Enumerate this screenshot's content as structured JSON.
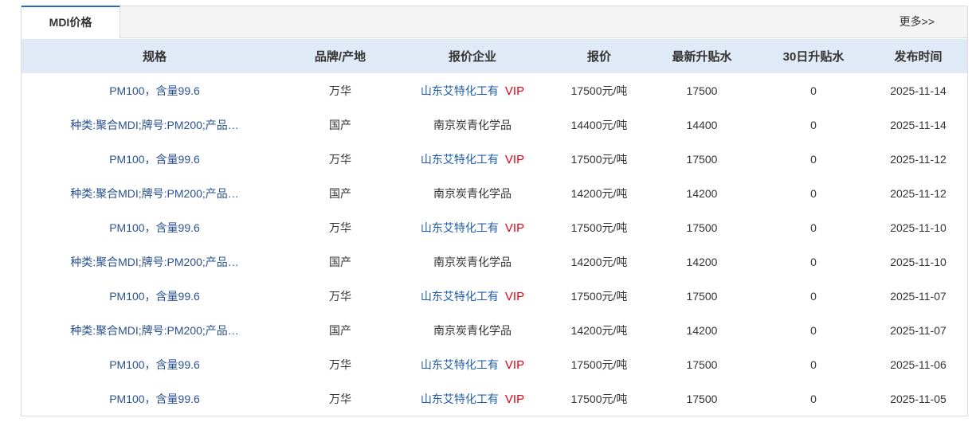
{
  "tabs": [
    {
      "label": "MDI价格",
      "active": true
    }
  ],
  "more_link": "更多>>",
  "colors": {
    "tab_accent": "#2c6bb3",
    "header_bg": "#e0eaf6",
    "spec_blue": "#2a5290",
    "link_blue": "#1f5cb0",
    "red": "#e60012"
  },
  "table": {
    "headers": [
      "规格",
      "品牌/产地",
      "报价企业",
      "报价",
      "最新升贴水",
      "30日升贴水",
      "发布时间"
    ],
    "rows": [
      {
        "spec": "PM100，含量99.6",
        "brand": "万华",
        "company": "山东艾特化工有",
        "company_link": true,
        "vip": "VIP",
        "price": "17500元/吨",
        "latest_diff": "17500",
        "diff_30d": "0",
        "date": "2025-11-14"
      },
      {
        "spec": "种类:聚合MDI;牌号:PM200;产品…",
        "brand": "国产",
        "company": "南京炭青化学品",
        "company_link": false,
        "price": "14400元/吨",
        "latest_diff": "14400",
        "diff_30d": "0",
        "date": "2025-11-14"
      },
      {
        "spec": "PM100，含量99.6",
        "brand": "万华",
        "company": "山东艾特化工有",
        "company_link": true,
        "vip": "VIP",
        "price": "17500元/吨",
        "latest_diff": "17500",
        "diff_30d": "0",
        "date": "2025-11-12"
      },
      {
        "spec": "种类:聚合MDI;牌号:PM200;产品…",
        "brand": "国产",
        "company": "南京炭青化学品",
        "company_link": false,
        "price": "14200元/吨",
        "latest_diff": "14200",
        "diff_30d": "0",
        "date": "2025-11-12"
      },
      {
        "spec": "PM100，含量99.6",
        "brand": "万华",
        "company": "山东艾特化工有",
        "company_link": true,
        "vip": "VIP",
        "price": "17500元/吨",
        "latest_diff": "17500",
        "diff_30d": "0",
        "date": "2025-11-10"
      },
      {
        "spec": "种类:聚合MDI;牌号:PM200;产品…",
        "brand": "国产",
        "company": "南京炭青化学品",
        "company_link": false,
        "price": "14200元/吨",
        "latest_diff": "14200",
        "diff_30d": "0",
        "date": "2025-11-10"
      },
      {
        "spec": "PM100，含量99.6",
        "brand": "万华",
        "company": "山东艾特化工有",
        "company_link": true,
        "vip": "VIP",
        "price": "17500元/吨",
        "latest_diff": "17500",
        "diff_30d": "0",
        "date": "2025-11-07"
      },
      {
        "spec": "种类:聚合MDI;牌号:PM200;产品…",
        "brand": "国产",
        "company": "南京炭青化学品",
        "company_link": false,
        "price": "14200元/吨",
        "latest_diff": "14200",
        "diff_30d": "0",
        "date": "2025-11-07"
      },
      {
        "spec": "PM100，含量99.6",
        "brand": "万华",
        "company": "山东艾特化工有",
        "company_link": true,
        "vip": "VIP",
        "price": "17500元/吨",
        "latest_diff": "17500",
        "diff_30d": "0",
        "date": "2025-11-06"
      },
      {
        "spec": "PM100，含量99.6",
        "brand": "万华",
        "company": "山东艾特化工有",
        "company_link": true,
        "vip": "VIP",
        "price": "17500元/吨",
        "latest_diff": "17500",
        "diff_30d": "0",
        "date": "2025-11-05"
      }
    ]
  }
}
